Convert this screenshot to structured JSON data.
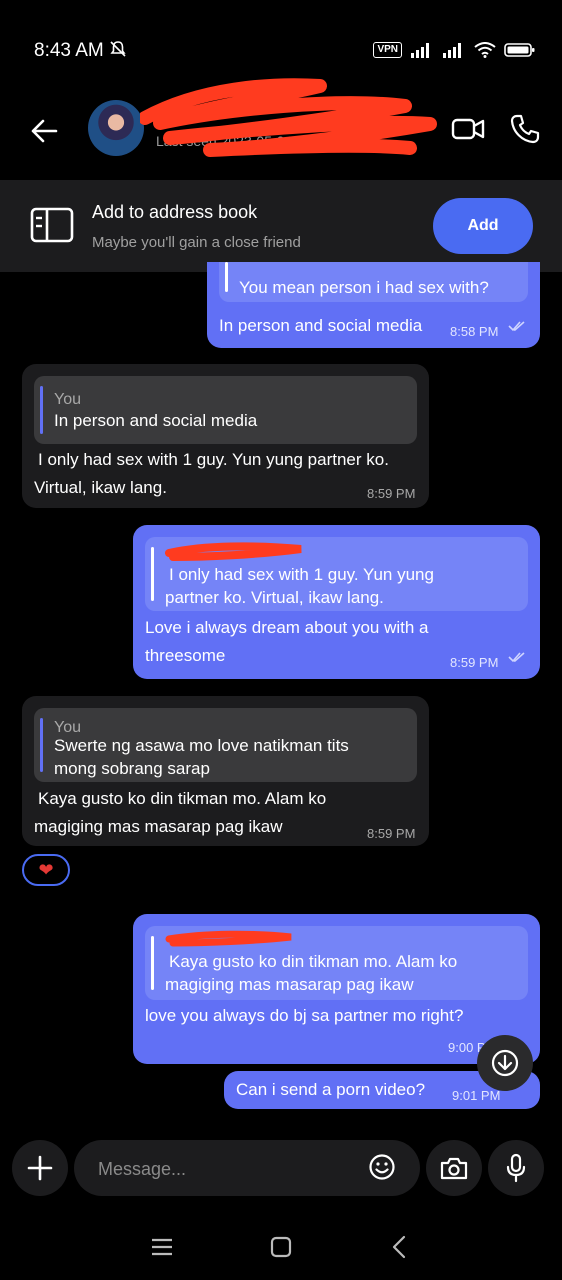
{
  "status_bar": {
    "time": "8:43 AM",
    "vpn": "VPN"
  },
  "header": {
    "contact_name": "+",
    "last_seen": "Last seen 2023-05-04"
  },
  "address_book": {
    "title": "Add to address book",
    "subtitle": "Maybe you'll gain a close friend",
    "add_label": "Add"
  },
  "messages": [
    {
      "direction": "out",
      "quote_text": "You mean person i had sex with?",
      "text": "In person and social media",
      "time": "8:58 PM"
    },
    {
      "direction": "in",
      "quote_name": "You",
      "quote_text": "In person and social media",
      "text_line1": "I only had sex with 1 guy. Yun yung partner ko.",
      "text_line2": "Virtual, ikaw lang.",
      "time": "8:59 PM"
    },
    {
      "direction": "out",
      "quote_line1": "I only had sex with 1 guy. Yun yung",
      "quote_line2": "partner ko. Virtual, ikaw lang.",
      "text_line1": "Love i always dream about you with a",
      "text_line2": "threesome",
      "time": "8:59 PM"
    },
    {
      "direction": "in",
      "quote_name": "You",
      "quote_line1": "Swerte ng asawa mo love natikman tits",
      "quote_line2": "mong sobrang sarap",
      "text_line1": "Kaya gusto ko din tikman mo. Alam ko",
      "text_line2": "magiging mas masarap pag ikaw",
      "time": "8:59 PM",
      "reaction": "❤"
    },
    {
      "direction": "out",
      "quote_line1": "Kaya gusto ko din tikman mo. Alam ko",
      "quote_line2": "magiging mas masarap pag ikaw",
      "text": "love you always do bj sa partner mo right?",
      "time": "9:00 PM"
    },
    {
      "direction": "out",
      "text": "Can i send a porn video?",
      "time": "9:01 PM"
    }
  ],
  "composer": {
    "placeholder": "Message..."
  },
  "colors": {
    "outgoing": "#6170f5",
    "incoming": "#1c1c1e",
    "accent": "#4a6bf2",
    "reaction": "#e53935"
  },
  "icons": [
    "back-arrow-icon",
    "video-call-icon",
    "phone-icon",
    "address-book-icon",
    "heart-icon",
    "scroll-down-icon",
    "plus-icon",
    "emoji-icon",
    "camera-icon",
    "mic-icon",
    "menu-icon",
    "home-icon",
    "nav-back-icon"
  ]
}
